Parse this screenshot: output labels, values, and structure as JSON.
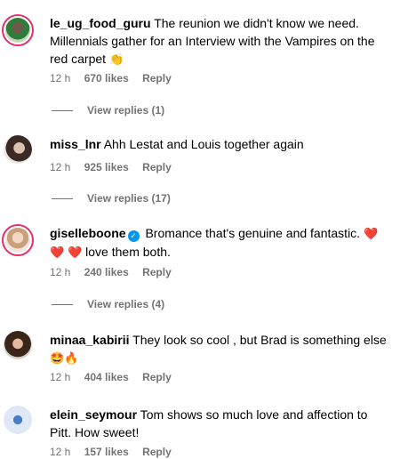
{
  "comments": [
    {
      "username": "le_ug_food_guru",
      "text": "The reunion we didn't know we need. Millennials gather for an Interview with the Vampires on the red carpet",
      "emoji": "👏",
      "time": "12 h",
      "likes": "670 likes",
      "reply": "Reply",
      "view_replies": "View replies (1)"
    },
    {
      "username": "miss_lnr",
      "text": "Ahh Lestat and Louis together again",
      "time": "12 h",
      "likes": "925 likes",
      "reply": "Reply",
      "view_replies": "View replies (17)"
    },
    {
      "username": "giselleboone",
      "verified_mark": "✓",
      "text_a": "Bromance that's genuine and fantastic.",
      "emoji_a": "❤️ ❤️",
      "emoji_b": "❤️",
      "text_b": "love them both.",
      "time": "12 h",
      "likes": "240 likes",
      "reply": "Reply",
      "view_replies": "View replies (4)"
    },
    {
      "username": "minaa_kabirii",
      "text": "They look so cool , but Brad is something else",
      "emoji": "🤩🔥",
      "time": "12 h",
      "likes": "404 likes",
      "reply": "Reply"
    },
    {
      "username": "elein_seymour",
      "text": "Tom shows so much love and affection to Pitt. How sweet!",
      "time": "12 h",
      "likes": "157 likes",
      "reply": "Reply"
    }
  ]
}
